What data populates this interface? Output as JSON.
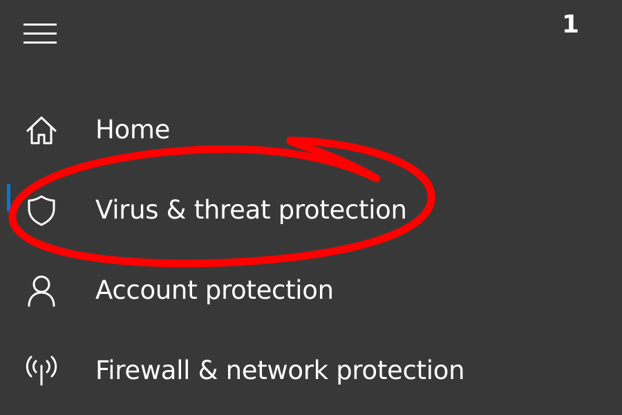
{
  "header": {
    "menu_icon": "hamburger-menu-icon",
    "step_number": "1"
  },
  "nav": {
    "items": [
      {
        "label": "Home",
        "icon": "home-icon",
        "selected": false
      },
      {
        "label": "Virus & threat protection",
        "icon": "shield-icon",
        "selected": true
      },
      {
        "label": "Account protection",
        "icon": "person-icon",
        "selected": false
      },
      {
        "label": "Firewall & network protection",
        "icon": "antenna-icon",
        "selected": false
      }
    ]
  },
  "colors": {
    "background": "#383838",
    "text": "#ffffff",
    "selection_accent": "#0078d7",
    "annotation": "#ff0000"
  }
}
